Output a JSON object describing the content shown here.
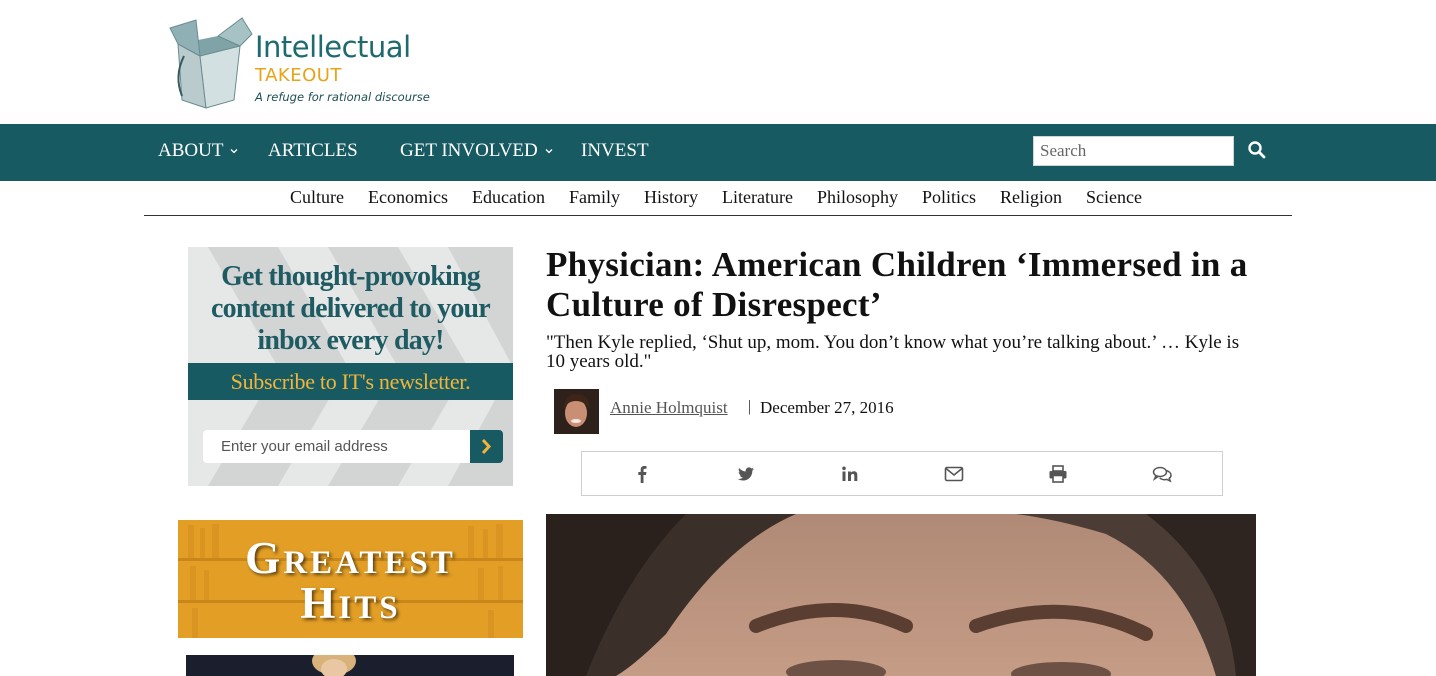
{
  "logo": {
    "name_line1": "Intellectual",
    "name_line2": "TAKEOUT",
    "tagline": "A refuge for rational discourse"
  },
  "main_nav": {
    "items": [
      {
        "label": "ABOUT",
        "has_dropdown": true
      },
      {
        "label": "ARTICLES",
        "has_dropdown": false
      },
      {
        "label": "GET INVOLVED",
        "has_dropdown": true
      },
      {
        "label": "INVEST",
        "has_dropdown": false
      }
    ],
    "search_placeholder": "Search",
    "search_icon": "search-icon"
  },
  "categories": [
    "Culture",
    "Economics",
    "Education",
    "Family",
    "History",
    "Literature",
    "Philosophy",
    "Politics",
    "Religion",
    "Science"
  ],
  "sidebar": {
    "newsletter": {
      "headline_line1": "Get thought-provoking",
      "headline_line2": "content delivered to your",
      "headline_line3": "inbox every day!",
      "bar_text": "Subscribe to IT's newsletter.",
      "email_placeholder": "Enter your email address",
      "submit_icon": "chevron-right-icon"
    },
    "greatest_hits": {
      "g": "G",
      "reatest": "REATEST",
      "h": "H",
      "its": "ITS"
    }
  },
  "article": {
    "title": "Physician: American Children ‘Immersed in a Culture of Disrespect’",
    "subtitle": "\"Then Kyle replied, ‘Shut up, mom. You don’t know what you’re talking about.’ … Kyle is 10 years old.\"",
    "author": "Annie Holmquist",
    "separator": "|",
    "date": "December 27, 2016",
    "share_icons": [
      "facebook-icon",
      "twitter-icon",
      "linkedin-icon",
      "email-icon",
      "print-icon",
      "comments-icon"
    ]
  },
  "colors": {
    "nav_bg": "#175a62",
    "accent_gold": "#e8a316",
    "greatest_hits_bg": "#e39e25"
  }
}
